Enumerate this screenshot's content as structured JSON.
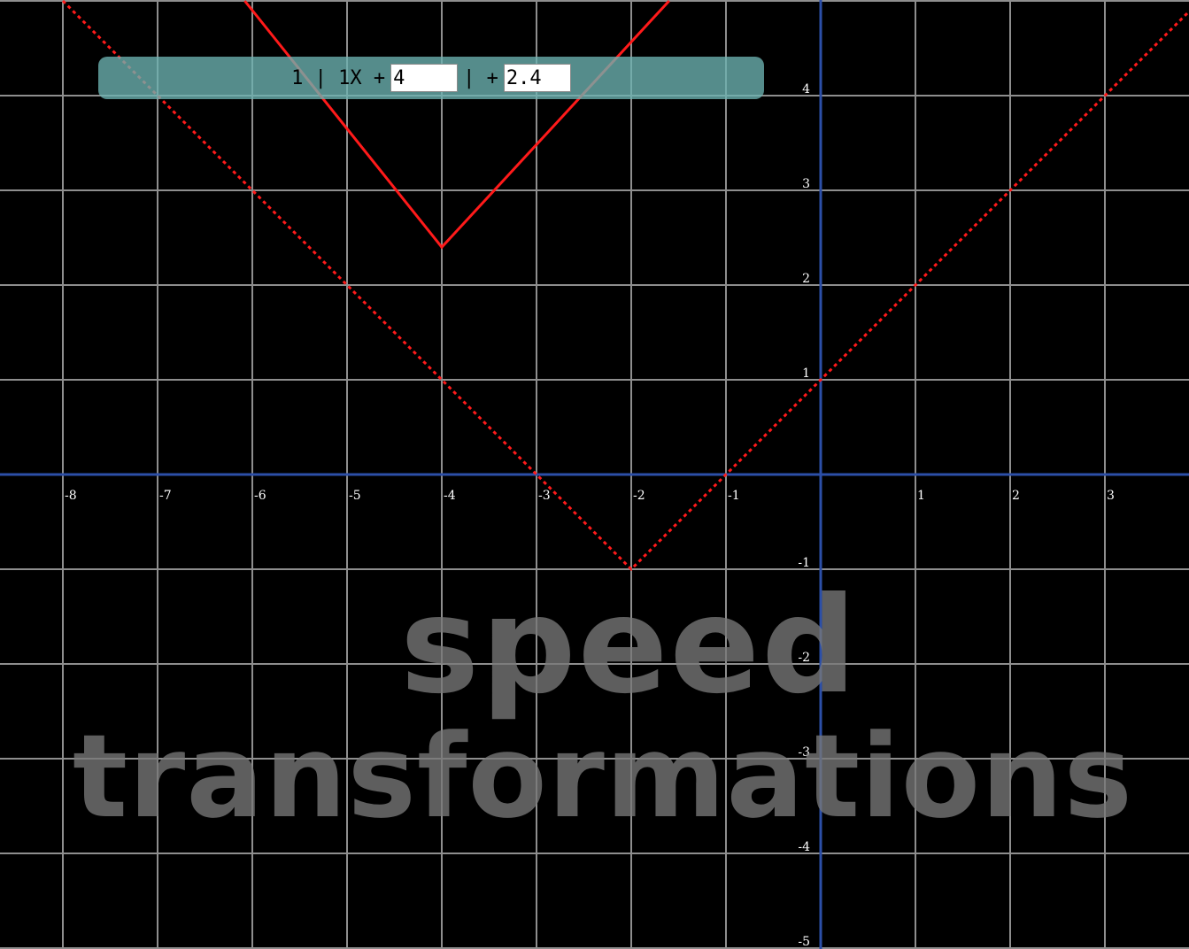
{
  "equation": {
    "leading_text": "1 | 1X +",
    "h_value": "4",
    "middle_text": "| +",
    "k_value": "2.4"
  },
  "watermark": {
    "line1": "speed",
    "line2": "transformations"
  },
  "chart_data": {
    "type": "line",
    "xlim": [
      -8.6,
      3.95
    ],
    "ylim": [
      -5,
      5
    ],
    "grid": true,
    "x_ticks": [
      "-8",
      "-7",
      "-6",
      "-5",
      "-4",
      "-3",
      "-2",
      "-1",
      "1",
      "2",
      "3"
    ],
    "y_ticks": [
      "4",
      "3",
      "2",
      "1",
      "-1",
      "-2",
      "-3",
      "-4",
      "-5"
    ],
    "series": [
      {
        "style": "solid",
        "color": "#ff1a1a",
        "points": [
          [
            -6.08,
            5.0
          ],
          [
            -4,
            2.4
          ],
          [
            -1.6,
            5.0
          ]
        ]
      },
      {
        "style": "dashed",
        "color": "#ff1a1a",
        "points": [
          [
            -8.0,
            5.0
          ],
          [
            -2,
            -1
          ],
          [
            4.0,
            5.0
          ]
        ]
      }
    ],
    "colors": {
      "grid": "#8e8e8e",
      "axis": "#2c4fa8",
      "background": "#000000"
    }
  }
}
